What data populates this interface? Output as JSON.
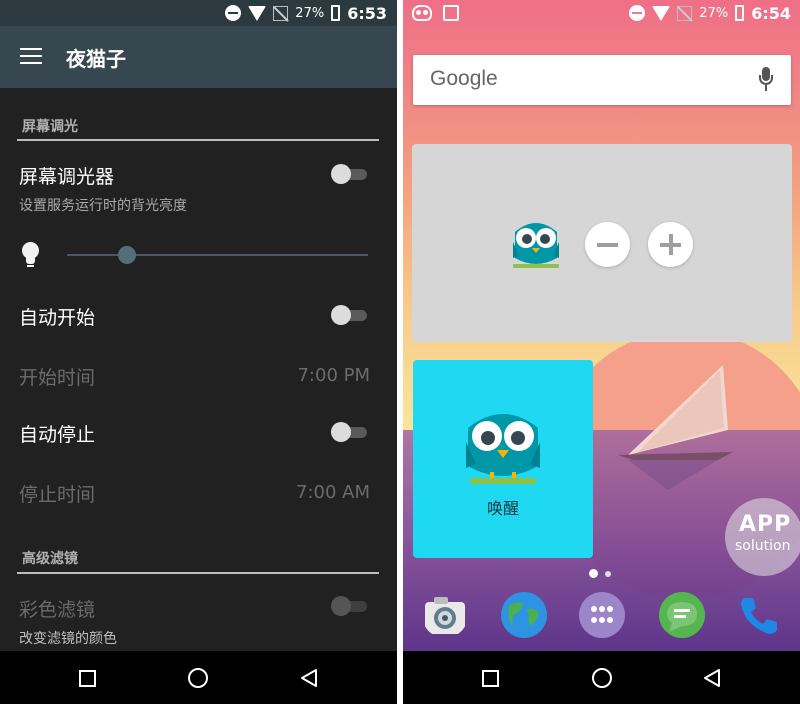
{
  "left": {
    "status": {
      "battery": "27%",
      "time": "6:53"
    },
    "toolbar": {
      "title": "夜猫子"
    },
    "section_screen": "屏幕调光",
    "dimmer": {
      "title": "屏幕调光器",
      "subtitle": "设置服务运行时的背光亮度",
      "enabled": false,
      "brightness": 0.2
    },
    "auto_start": {
      "title": "自动开始",
      "enabled": false
    },
    "start_time": {
      "title": "开始时间",
      "value": "7:00 PM"
    },
    "auto_stop": {
      "title": "自动停止",
      "enabled": false
    },
    "stop_time": {
      "title": "停止时间",
      "value": "7:00 AM"
    },
    "section_filter": "高级滤镜",
    "color_filter": {
      "title": "彩色滤镜",
      "subtitle": "改变滤镜的颜色",
      "enabled": false
    }
  },
  "right": {
    "status": {
      "battery": "27%",
      "time": "6:54"
    },
    "search": {
      "logo": "Google"
    },
    "wake_widget": {
      "label": "唤醒"
    },
    "badge": {
      "line1": "APP",
      "line2": "solution"
    },
    "page_indicator": {
      "pages": 2,
      "current": 1
    }
  },
  "colors": {
    "toolbar": "#37474f",
    "left_bg": "#212121",
    "wake_widget": "#1fd8f2",
    "widget_gray": "#d6d6d6"
  },
  "icons": [
    "menu-icon",
    "do-not-disturb-icon",
    "wifi-icon",
    "no-signal-icon",
    "battery-icon",
    "lightbulb-icon",
    "owl-notification-icon",
    "image-notification-icon",
    "mic-icon",
    "minus-icon",
    "plus-icon",
    "camera-icon",
    "earth-icon",
    "apps-icon",
    "messages-icon",
    "phone-icon",
    "recents-icon",
    "home-icon",
    "back-icon"
  ]
}
